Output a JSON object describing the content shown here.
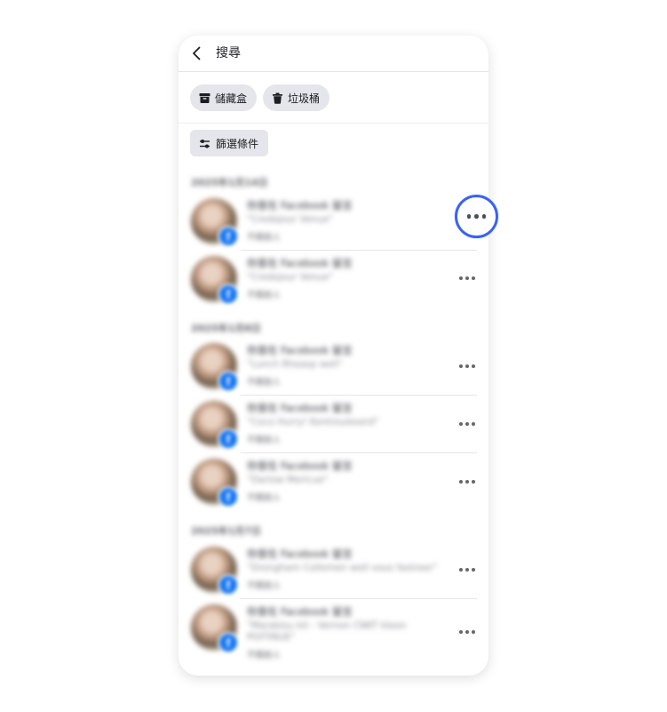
{
  "header": {
    "title": "搜尋",
    "back_icon": "chevron-left-icon"
  },
  "chips": [
    {
      "label": "儲藏盒",
      "icon": "archive-box-icon"
    },
    {
      "label": "垃圾桶",
      "icon": "trash-icon"
    }
  ],
  "filter": {
    "label": "篩選條件",
    "icon": "sliders-icon"
  },
  "groups": [
    {
      "date": "2025年1月14日",
      "items": [
        {
          "title": "你曾在 Facebook 留言",
          "subtitle": "\"Credojour Venue\"",
          "meta": "不開放人"
        },
        {
          "title": "你曾在 Facebook 留言",
          "subtitle": "\"Credojour Venue\"",
          "meta": "不開放人"
        }
      ]
    },
    {
      "date": "2025年1月8日",
      "items": [
        {
          "title": "你曾在 Facebook 留言",
          "subtitle": "\"Lunch Rheasp well\"",
          "meta": "不開放人"
        },
        {
          "title": "你曾在 Facebook 留言",
          "subtitle": "\"Coco Hurry! Kontrouleserd\"",
          "meta": "不開放人"
        },
        {
          "title": "你曾在 Facebook 留言",
          "subtitle": "\"Darlow Mericue\"",
          "meta": "不開放人"
        }
      ]
    },
    {
      "date": "2025年1月7日",
      "items": [
        {
          "title": "你曾在 Facebook 留言",
          "subtitle": "\"Drongham Collemen well vous fastreer\"",
          "meta": "不開放人"
        },
        {
          "title": "你曾在 Facebook 留言",
          "subtitle": "\"Marabisu kit - Vernon CNKT kleon",
          "subtitle2": "POITINUE\"",
          "meta": "不開放人"
        }
      ]
    }
  ],
  "more_icon": "more-horizontal-icon",
  "highlight_color": "#3a63f1",
  "accent_color": "#1877f2"
}
